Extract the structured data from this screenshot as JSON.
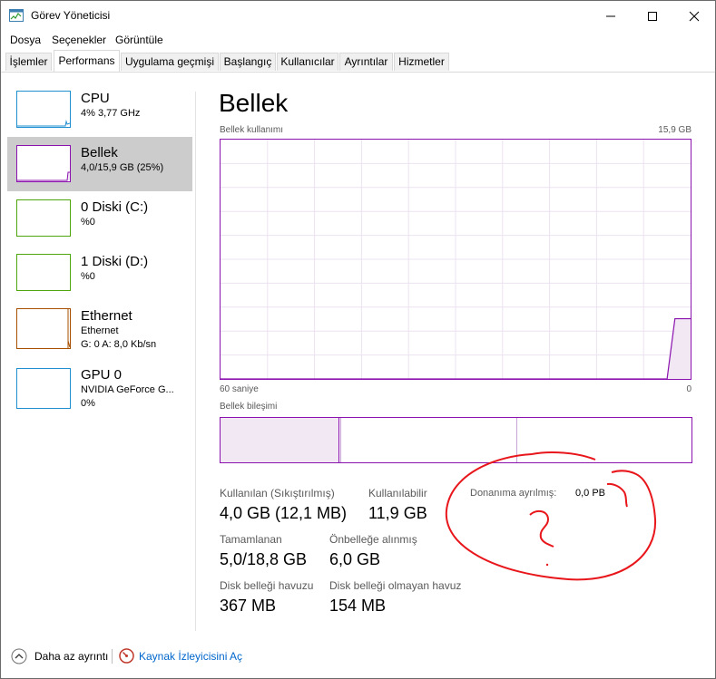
{
  "window": {
    "title": "Görev Yöneticisi",
    "title_icon": "task-manager-icon",
    "controls": [
      "minimize-icon",
      "maximize-icon",
      "close-icon"
    ]
  },
  "menu": [
    "Dosya",
    "Seçenekler",
    "Görüntüle"
  ],
  "tabs": [
    "İşlemler",
    "Performans",
    "Uygulama geçmişi",
    "Başlangıç",
    "Kullanıcılar",
    "Ayrıntılar",
    "Hizmetler"
  ],
  "active_tab": "Performans",
  "sidebar": [
    {
      "title": "CPU",
      "sub1": "4% 3,77 GHz",
      "sub2": "",
      "color": "#1f8fd0"
    },
    {
      "title": "Bellek",
      "sub1": "4,0/15,9 GB (25%)",
      "sub2": "",
      "color": "#8b12ae"
    },
    {
      "title": "0 Diski (C:)",
      "sub1": "%0",
      "sub2": "",
      "color": "#4da60c"
    },
    {
      "title": "1 Diski (D:)",
      "sub1": "%0",
      "sub2": "",
      "color": "#4da60c"
    },
    {
      "title": "Ethernet",
      "sub1": "Ethernet",
      "sub2": "G: 0 A: 8,0 Kb/sn",
      "color": "#a74f01"
    },
    {
      "title": "GPU 0",
      "sub1": "NVIDIA GeForce G...",
      "sub2": "0%",
      "color": "#1f8fd0"
    }
  ],
  "main": {
    "title": "Bellek",
    "usage_label": "Bellek kullanımı",
    "usage_max": "15,9 GB",
    "time_label": "60 saniye",
    "time_min": "0",
    "composition_label": "Bellek bileşimi",
    "accent": "#8b12ae"
  },
  "chart_data": {
    "type": "area",
    "title": "Bellek kullanımı",
    "ylim": [
      0,
      15.9
    ],
    "xlim": [
      60,
      0
    ],
    "x": [
      60,
      3,
      2,
      0
    ],
    "values": [
      0,
      0,
      4.0,
      4.0
    ],
    "grid": true
  },
  "stats": {
    "used_label": "Kullanılan (Sıkıştırılmış)",
    "used_value": "4,0 GB (12,1 MB)",
    "available_label": "Kullanılabilir",
    "available_value": "11,9 GB",
    "hardware_label": "Donanıma ayrılmış:",
    "hardware_value": "0,0 PB",
    "committed_label": "Tamamlanan",
    "committed_value": "5,0/18,8 GB",
    "cached_label": "Önbelleğe alınmış",
    "cached_value": "6,0 GB",
    "paged_label": "Disk belleği havuzu",
    "paged_value": "367 MB",
    "nonpaged_label": "Disk belleği olmayan havuz",
    "nonpaged_value": "154 MB"
  },
  "footer": {
    "less_details": "Daha az ayrıntı",
    "resource_monitor": "Kaynak İzleyicisini Aç"
  }
}
